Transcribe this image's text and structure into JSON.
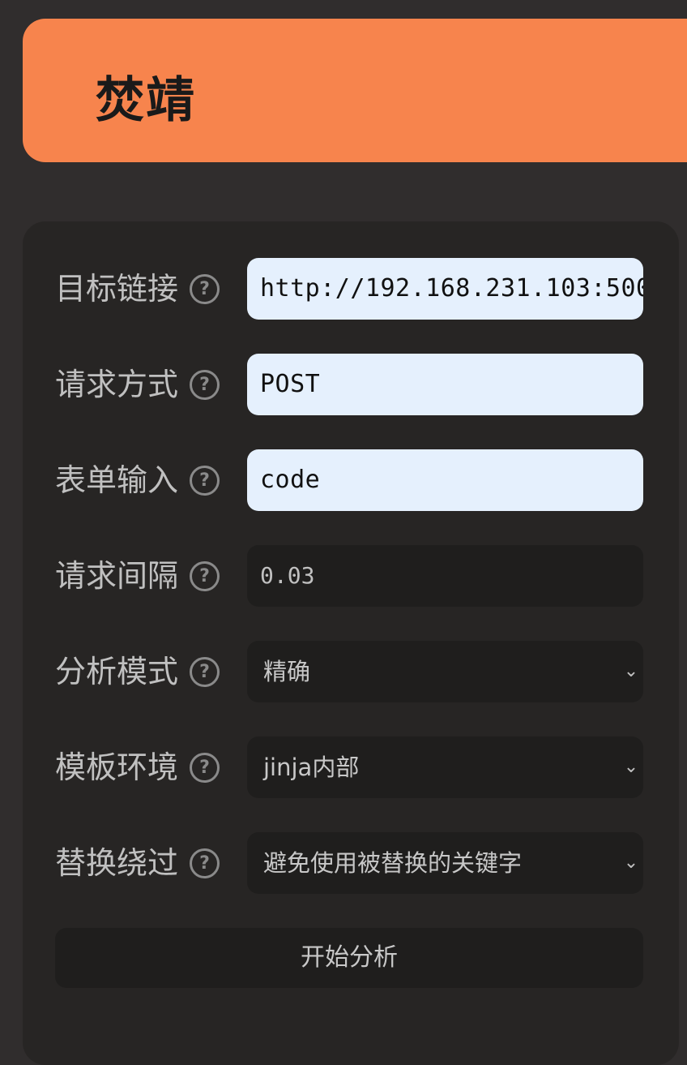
{
  "header": {
    "title": "焚靖"
  },
  "form": {
    "target_url": {
      "label": "目标链接",
      "value": "http://192.168.231.103:500"
    },
    "method": {
      "label": "请求方式",
      "value": "POST"
    },
    "form_input": {
      "label": "表单输入",
      "value": "code"
    },
    "interval": {
      "label": "请求间隔",
      "value": "0.03"
    },
    "analysis_mode": {
      "label": "分析模式",
      "value": "精确"
    },
    "template_env": {
      "label": "模板环境",
      "value": "jinja内部"
    },
    "replace_bypass": {
      "label": "替换绕过",
      "value": "避免使用被替换的关键字"
    },
    "help_glyph": "?",
    "chevron_glyph": "⌄",
    "start_label": "开始分析"
  },
  "colors": {
    "header_bg": "#f7844d",
    "page_bg": "#302d2d",
    "panel_bg": "#272524",
    "input_light_bg": "#e5f0fd",
    "input_dark_bg": "#1f1e1d"
  }
}
